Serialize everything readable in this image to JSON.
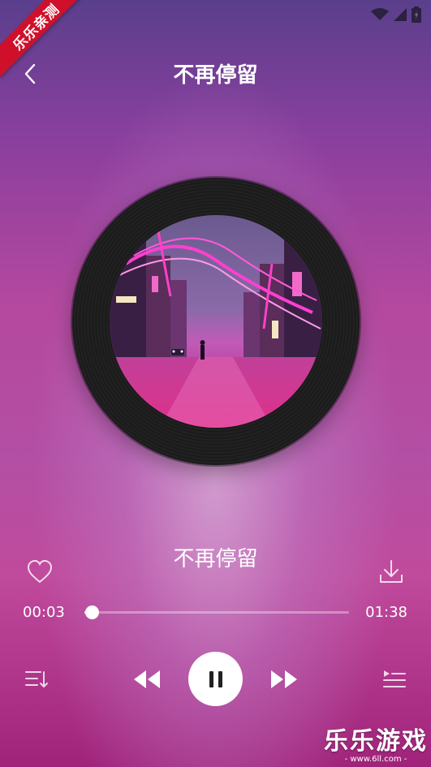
{
  "status_bar": {
    "ribbon_text": "乐乐亲测",
    "icons": [
      "wifi-icon",
      "cell-signal-icon",
      "battery-icon"
    ]
  },
  "header": {
    "back_icon": "chevron-left-icon",
    "title": "不再停留"
  },
  "player": {
    "song_name": "不再停留",
    "current_time": "00:03",
    "total_time": "01:38",
    "progress": 0.03,
    "is_playing": true
  },
  "icons": {
    "favorite": "heart-icon",
    "download": "download-icon",
    "playlist_mode": "list-order-icon",
    "prev": "rewind-icon",
    "pause": "pause-icon",
    "next": "fast-forward-icon",
    "queue": "queue-list-icon"
  },
  "watermark": {
    "main": "乐乐游戏",
    "sub": "- www.6ll.com -"
  },
  "colors": {
    "ribbon": "#d0102a",
    "disc": "#1d1d1d",
    "accent": "#ffffff"
  }
}
